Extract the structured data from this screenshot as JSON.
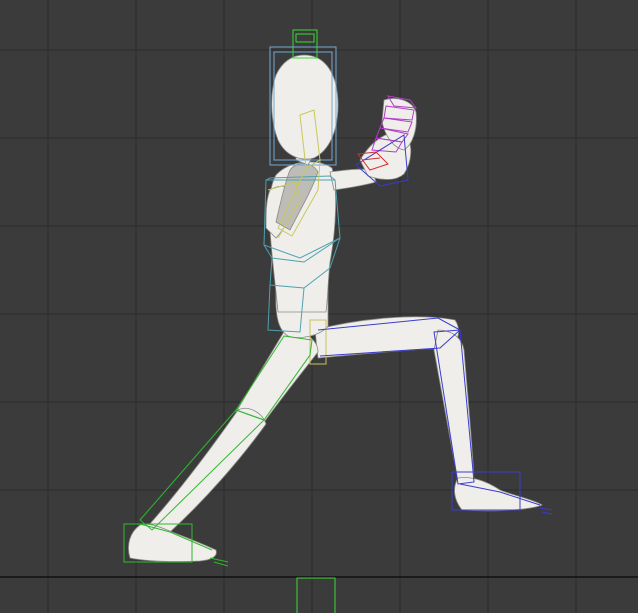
{
  "viewport": {
    "background": "#3b3b3b",
    "grid_color": "#2b2b2b",
    "ground_line_color": "#111111"
  },
  "figure": {
    "body_color": "#efeeea",
    "shade_color": "#bdbcb6",
    "outline_color": "#8a8a86"
  },
  "rig_colors": {
    "head_box": "#6fa8d8",
    "spine_box": "#4fa0b0",
    "left_leg_bones": "#2fb82f",
    "right_leg_bones": "#3b3bd0",
    "right_hand_bones": "#b43bc8",
    "wrist_bone": "#d03030",
    "left_arm_bones": "#c8c85a",
    "head_top_box": "#38d838",
    "pelvis_box": "#c8c060"
  },
  "icons": [
    "viewport-grid-icon",
    "rig-bone-icon",
    "foot-control-icon"
  ]
}
